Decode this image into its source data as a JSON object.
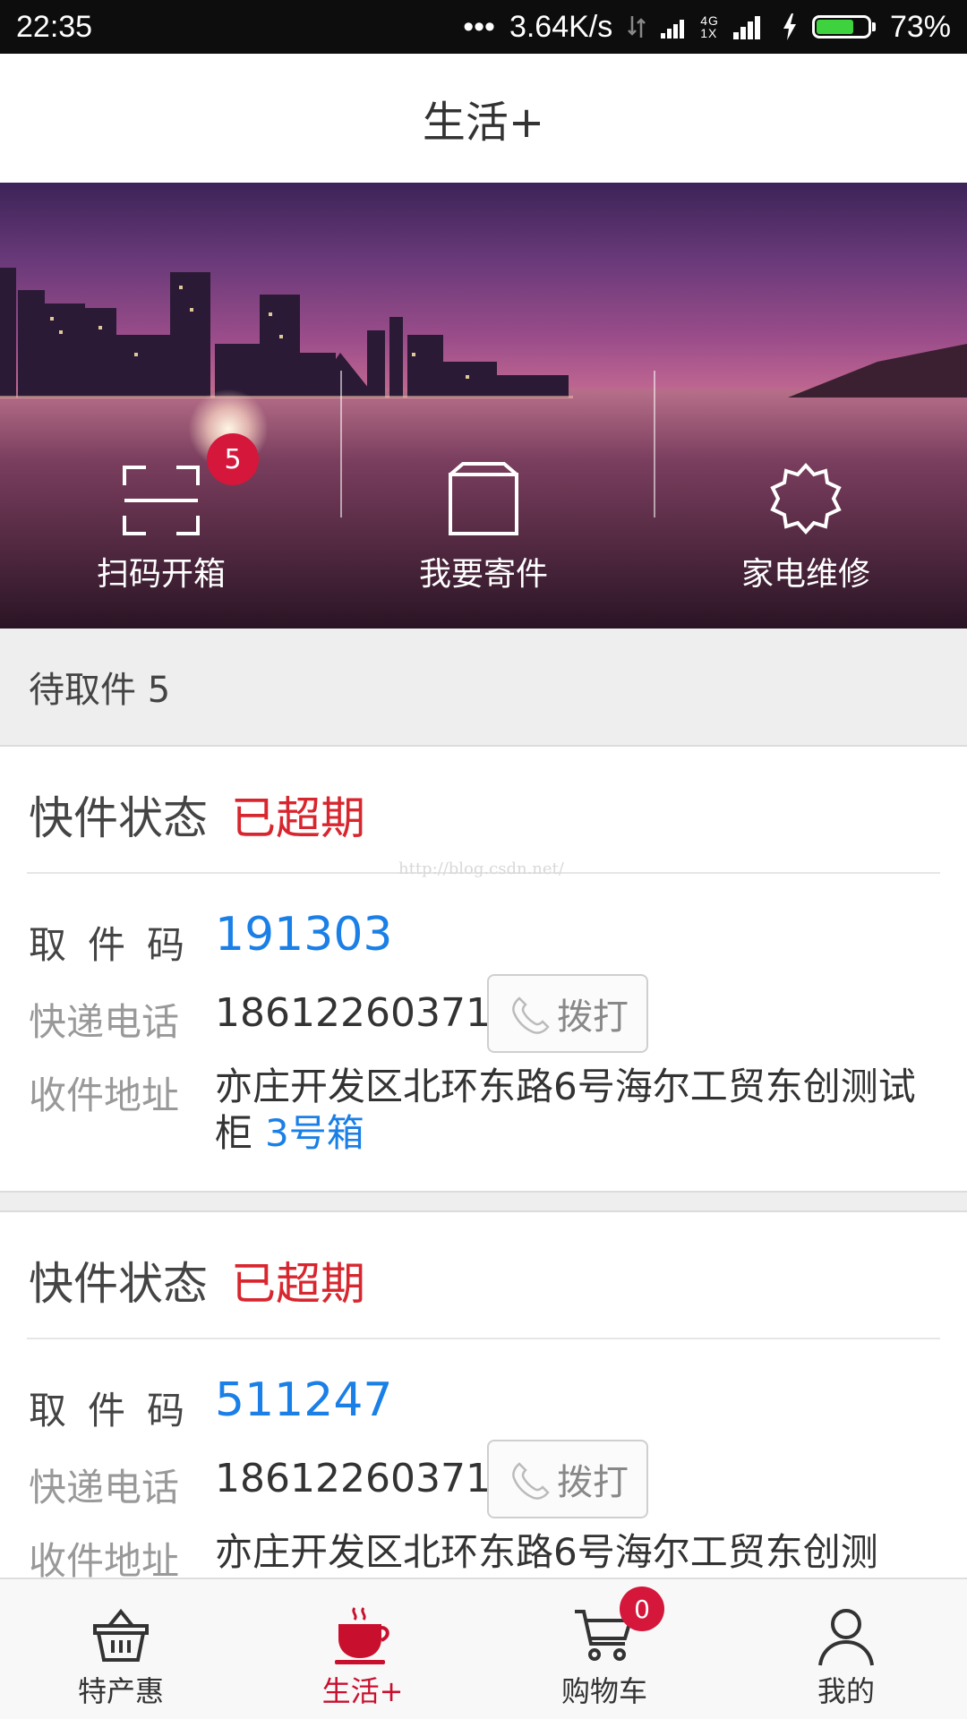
{
  "status_bar": {
    "time": "22:35",
    "dots": "•••",
    "net_speed": "3.64K/s",
    "network": "4G",
    "sim_slot": "1X",
    "battery": "73%",
    "battery_level": 0.73
  },
  "header": {
    "title": "生活+"
  },
  "banner": {
    "actions": [
      {
        "label": "扫码开箱",
        "icon": "scan-icon",
        "badge": "5"
      },
      {
        "label": "我要寄件",
        "icon": "box-icon"
      },
      {
        "label": "家电维修",
        "icon": "badge-star-icon"
      }
    ]
  },
  "pending": {
    "label": "待取件 5"
  },
  "parcels": [
    {
      "status_label": "快件状态",
      "status": "已超期",
      "code_label": "取件码",
      "code": "191303",
      "phone_label": "快递电话",
      "phone": "18612260371",
      "call_label": "拨打",
      "addr_label": "收件地址",
      "address": "亦庄开发区北环东路6号海尔工贸东创测试柜",
      "box": "3号箱"
    },
    {
      "status_label": "快件状态",
      "status": "已超期",
      "code_label": "取件码",
      "code": "511247",
      "phone_label": "快递电话",
      "phone": "18612260371",
      "call_label": "拨打",
      "addr_label": "收件地址",
      "address": "亦庄开发区北环东路6号海尔工贸东创测"
    }
  ],
  "watermark": "http://blog.csdn.net/",
  "tabbar": {
    "tabs": [
      {
        "label": "特产惠",
        "icon": "basket-icon"
      },
      {
        "label": "生活+",
        "icon": "coffee-cup-icon",
        "active": true
      },
      {
        "label": "购物车",
        "icon": "cart-icon",
        "badge": "0"
      },
      {
        "label": "我的",
        "icon": "person-icon"
      }
    ]
  },
  "colors": {
    "accent_red": "#c8102e",
    "status_red": "#d8262e",
    "link_blue": "#1a7fe6",
    "badge_red": "#d4173b"
  }
}
